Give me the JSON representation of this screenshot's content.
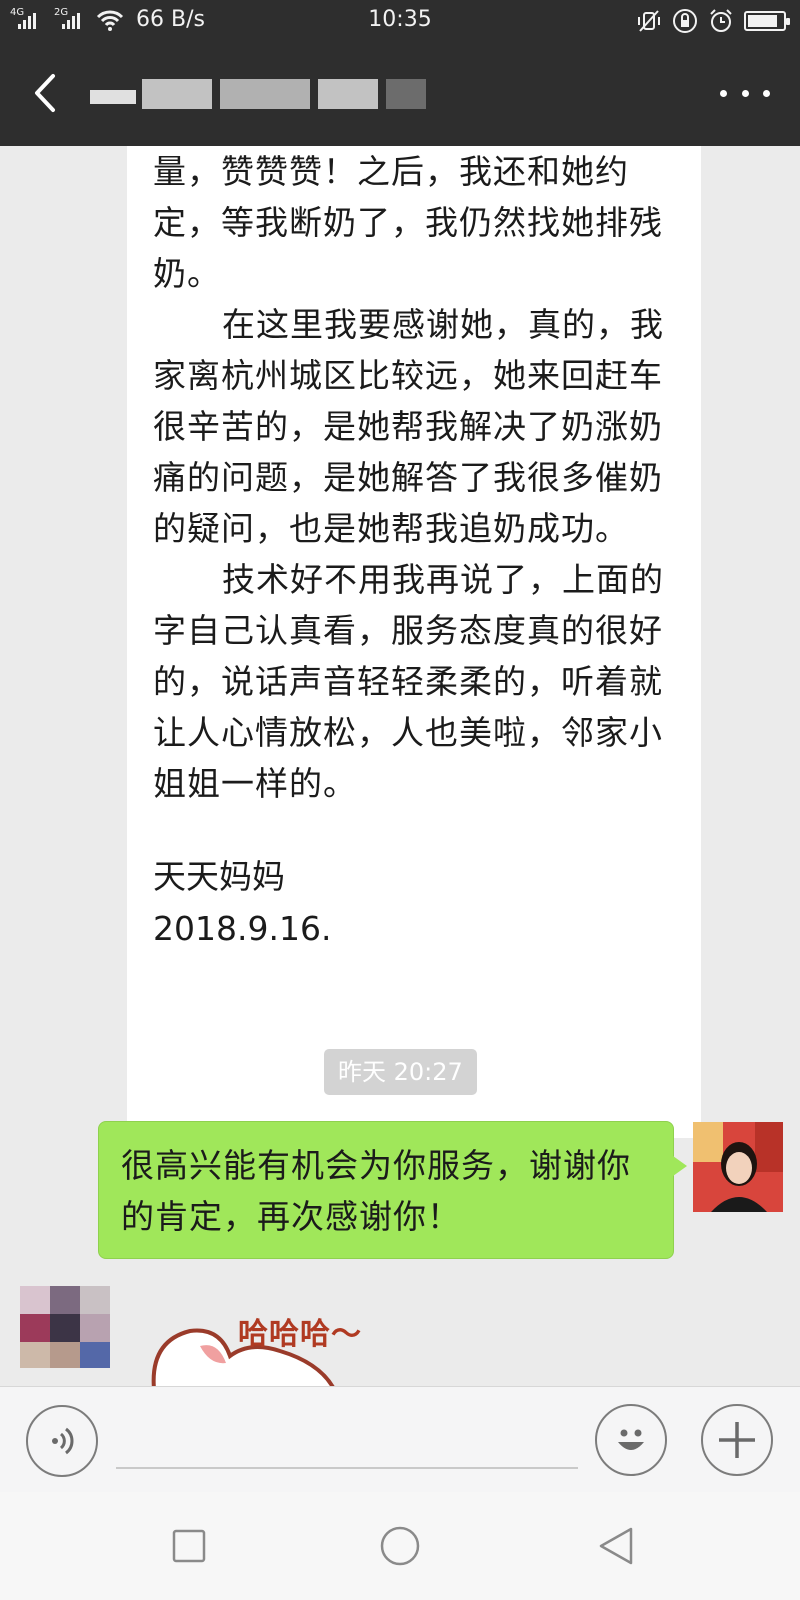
{
  "status_bar": {
    "network_1": "4G",
    "network_2": "2G",
    "speed": "66 B/s",
    "time": "10:35",
    "battery_level_percent": 85
  },
  "header": {
    "back_icon": "chevron-left-icon",
    "more_icon": "more-dots-icon"
  },
  "messages": {
    "card_text": "量，赞赞赞！之后，我还和她约\n定，等我断奶了，我仍然找她排残\n奶。\n      在这里我要感谢她，真的，我\n家离杭州城区比较远，她来回赶车\n很辛苦的，是她帮我解决了奶涨奶\n痛的问题，是她解答了我很多催奶\n的疑问，也是她帮我追奶成功。\n      技术好不用我再说了，上面的\n字自己认真看，服务态度真的很好\n的，说话声音轻轻柔柔的，听着就\n让人心情放松，人也美啦，邻家小\n姐姐一样的。",
    "card_sign_name": "天天妈妈",
    "card_sign_date": "2018.9.16.",
    "timestamp": "昨天 20:27",
    "outgoing_text": "很高兴能有机会为你服务，谢谢你\n的肯定，再次感谢你！",
    "sticker_text": "哈哈哈～"
  },
  "input_bar": {
    "voice_icon": "voice-icon",
    "emoji_icon": "emoji-icon",
    "plus_icon": "plus-icon",
    "input_value": ""
  },
  "nav_bar": {
    "recent_icon": "square-icon",
    "home_icon": "circle-icon",
    "back_icon": "triangle-back-icon"
  },
  "colors": {
    "header_bg": "#2e2e2e",
    "chat_bg": "#ebebeb",
    "outgoing_bubble": "#a0e75a",
    "card_bg": "#ffffff"
  }
}
